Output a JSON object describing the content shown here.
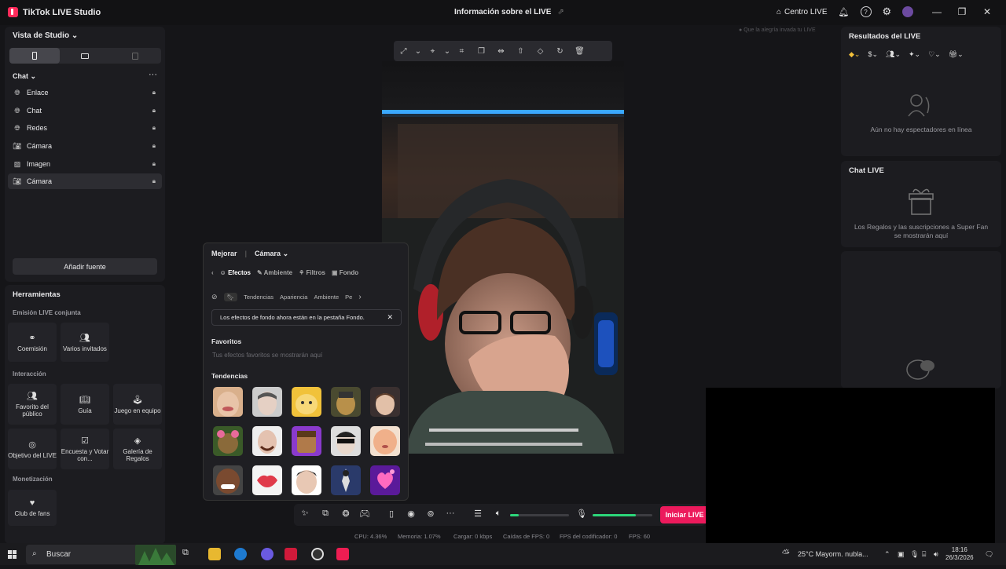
{
  "titlebar": {
    "app_name": "TikTok LIVE Studio",
    "center_title": "Información sobre el LIVE",
    "centro_live": "Centro LIVE",
    "window_controls": [
      "minimize",
      "maximize",
      "close"
    ]
  },
  "studio": {
    "title": "Vista de Studio",
    "chat_section": "Chat",
    "sources": [
      {
        "icon": "globe-icon",
        "label": "Enlace"
      },
      {
        "icon": "globe-icon",
        "label": "Chat"
      },
      {
        "icon": "globe-icon",
        "label": "Redes"
      },
      {
        "icon": "camera-icon",
        "label": "Cámara"
      },
      {
        "icon": "image-icon",
        "label": "Imagen"
      },
      {
        "icon": "camera-icon",
        "label": "Cámara",
        "selected": true
      }
    ],
    "add_source": "Añadir fuente"
  },
  "tools": {
    "title": "Herramientas",
    "sections": [
      {
        "name": "Emisión LIVE conjunta",
        "items": [
          "Coemisión",
          "Varios invitados"
        ]
      },
      {
        "name": "Interacción",
        "items": [
          "Favorito del público",
          "Guía",
          "Juego en equipo",
          "Objetivo del LIVE",
          "Encuesta y Votar con...",
          "Galería de Regalos"
        ]
      },
      {
        "name": "Monetización",
        "items": [
          "Club de fans"
        ]
      }
    ]
  },
  "canvas": {
    "hint": "Que la alegría invada tu LIVE"
  },
  "effects": {
    "header": [
      "Mejorar",
      "Cámara"
    ],
    "tabs": [
      "Efectos",
      "Ambiente",
      "Filtros",
      "Fondo"
    ],
    "active_tab": "Efectos",
    "categories": [
      "Tendencias",
      "Apariencia",
      "Ambiente",
      "Pe"
    ],
    "notice": "Los efectos de fondo ahora están en la pestaña Fondo.",
    "favorites_title": "Favoritos",
    "favorites_empty": "Tus efectos favoritos se mostrarán aquí",
    "trending_title": "Tendencias"
  },
  "controls": {
    "go_live": "Iniciar LIVE",
    "speaker_level": 0.15,
    "mic_level": 0.72
  },
  "stats": {
    "cpu": "CPU: 4.36%",
    "memory": "Memoria: 1.07%",
    "upload": "Cargar: 0 kbps",
    "fps_drops": "Caídas de FPS: 0",
    "encoder_fps": "FPS del codificador: 0",
    "fps": "FPS: 60"
  },
  "right": {
    "results_title": "Resultados del LIVE",
    "no_viewers": "Aún no hay espectadores en línea",
    "chat_title": "Chat LIVE",
    "gifts_note": "Los Regalos y las suscripciones a Super Fan se mostrarán aquí"
  },
  "taskbar": {
    "search": "Buscar",
    "weather": "25°C  Mayorm. nubla...",
    "time": "18:16",
    "date": "26/3/2026"
  },
  "colors": {
    "accent": "#ec1a5c",
    "level": "#2cd67a",
    "background": "#151518"
  }
}
